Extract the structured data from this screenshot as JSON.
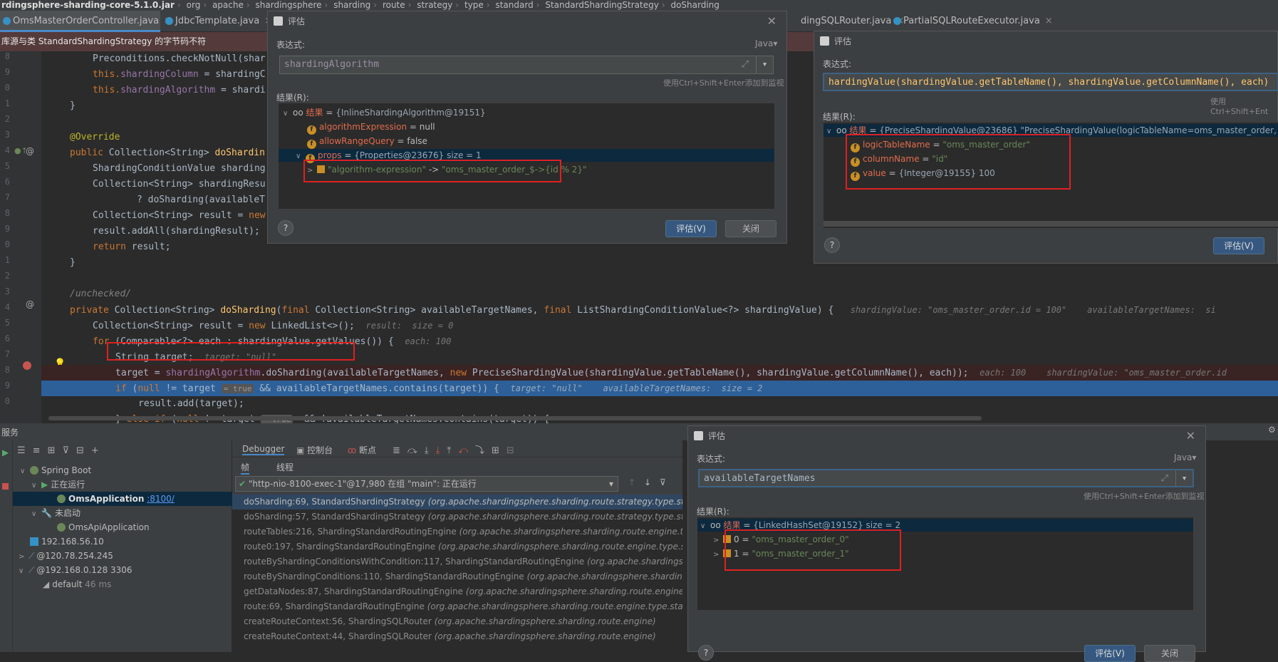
{
  "breadcrumb": [
    "rdingsphere-sharding-core-5.1.0.jar",
    "org",
    "apache",
    "shardingsphere",
    "sharding",
    "route",
    "strategy",
    "type",
    "standard",
    "StandardShardingStrategy",
    "doSharding"
  ],
  "tabs": [
    {
      "label": "OmsMasterOrderController.java",
      "active": true
    },
    {
      "label": "JdbcTemplate.java",
      "active": false
    },
    {
      "label": "dingSQLRouter.java",
      "active": false
    },
    {
      "label": "PartialSQLRouteExecutor.java",
      "active": false
    }
  ],
  "banner": "库源与类 StandardShardingStrategy 的字节码不符",
  "line_numbers": [
    "8",
    "9",
    "0",
    "1",
    "2",
    "3",
    "4",
    "5",
    "6",
    "7",
    "8",
    "9",
    "0",
    "1",
    "2",
    "3",
    "4",
    "5",
    "6",
    "7",
    "8",
    "9",
    "0"
  ],
  "code": {
    "l0": "Preconditions.checkNotNull(shar",
    "l1a": "this.",
    "l1b": "shardingColumn",
    "l1c": " = shardingC",
    "l2a": "this.",
    "l2b": "shardingAlgorithm",
    "l2c": " = shardi",
    "l3": "}",
    "l5": "@Override",
    "l6a": "public",
    "l6b": " Collection<String> ",
    "l6c": "doShardin",
    "l7": "ShardingConditionValue sharding",
    "l8": "Collection<String> shardingResu",
    "l9": "? doSharding(availableT",
    "l10a": "Collection<String> result = ",
    "l10b": "new",
    "l11": "result.addAll(shardingResult);",
    "l12a": "return",
    "l12b": " result;",
    "l13": "}",
    "l15": "/unchecked/",
    "l16a": "private",
    "l16b": " Collection<String> ",
    "l16c": "doSharding",
    "l16d": "(",
    "l16e": "final",
    "l16f": " Collection<String> availableTargetNames, ",
    "l16g": "final",
    "l16h": " ListShardingConditionValue<?> shardingValue) {",
    "l16hint": "shardingValue: \"oms_master_order.id = 100\"    availableTargetNames:  si",
    "l17a": "Collection<String> result = ",
    "l17b": "new",
    "l17c": " LinkedList<>();",
    "l17hint": "result:  size = 0",
    "l18a": "for",
    "l18b": " (Comparable<?> each : shardingValue.getValues()) {",
    "l18hint": "each: 100",
    "l19a": "String target;",
    "l19hint": "target: \"null\"",
    "l20a": "target = ",
    "l20b": "shardingAlgorithm",
    "l20c": ".doSharding(availableTargetNames, ",
    "l20d": "new",
    "l20e": " PreciseShardingValue(shardingValue.getTableName(), shardingValue.getColumnName(), each));",
    "l20hint": "each: 100    shardingValue: \"oms_master_order.id",
    "l21a": "if",
    "l21b": " (",
    "l21c": "null",
    "l21d": " != target ",
    "l21badge": "= true",
    "l21e": " && availableTargetNames.contains(target)) {",
    "l21hint": "target: \"null\"    availableTargetNames:  size = 2",
    "l22": "result.add(target);",
    "l23a": "} ",
    "l23b": "else if",
    "l23c": " (",
    "l23d": "null",
    "l23e": " != target ",
    "l23badge": "= true",
    "l23f": "  && !availableTargetNames.contains(target)) {"
  },
  "dialog1": {
    "title": "评估",
    "expr_label": "表达式:",
    "lang": "Java",
    "expression": "shardingAlgorithm",
    "hint": "使用Ctrl+Shift+Enter添加到监视",
    "result_label": "结果(R):",
    "root": {
      "key": "结果",
      "value": "{InlineShardingAlgorithm@19151}"
    },
    "rows": [
      {
        "key": "algorithmExpression",
        "value": "null"
      },
      {
        "key": "allowRangeQuery",
        "value": "false"
      },
      {
        "key": "props",
        "value": "{Properties@23676}  size = 1"
      },
      {
        "key": "\"algorithm-expression\"",
        "value": "\"oms_master_order_$->{id % 2}\""
      }
    ],
    "evaluate": "评估(V)",
    "close": "关闭"
  },
  "dialog2": {
    "title": "评估",
    "expr_label": "表达式:",
    "expression": "hardingValue(shardingValue.getTableName(), shardingValue.getColumnName(), each)",
    "hint": "使用Ctrl+Shift+Ent",
    "result_label": "结果(R):",
    "root": {
      "key": "结果",
      "value": "{PreciseShardingValue@23686} \"PreciseShardingValue(logicTableName=oms_master_order, co"
    },
    "rows": [
      {
        "key": "logicTableName",
        "value": "\"oms_master_order\""
      },
      {
        "key": "columnName",
        "value": "\"id\""
      },
      {
        "key": "value",
        "value": "{Integer@19155} 100"
      }
    ],
    "evaluate": "评估(V)"
  },
  "dialog3": {
    "title": "评估",
    "expr_label": "表达式:",
    "lang": "Java",
    "expression": "availableTargetNames",
    "hint": "使用Ctrl+Shift+Enter添加到监视",
    "result_label": "结果(R):",
    "root": {
      "key": "结果",
      "value": "{LinkedHashSet@19152}  size = 2"
    },
    "rows": [
      {
        "key": "0",
        "value": "\"oms_master_order_0\""
      },
      {
        "key": "1",
        "value": "\"oms_master_order_1\""
      }
    ],
    "evaluate": "评估(V)",
    "close": "关闭"
  },
  "services": {
    "header": "服务",
    "tree": [
      {
        "label": "Spring Boot"
      },
      {
        "label": "正在运行"
      },
      {
        "label": "OmsApplication",
        "port": ":8100/"
      },
      {
        "label": "未启动"
      },
      {
        "label": "OmsApiApplication"
      },
      {
        "label": "192.168.56.10"
      },
      {
        "label": "@120.78.254.245"
      },
      {
        "label": "@192.168.0.128 3306"
      },
      {
        "label": "default",
        "time": "46 ms"
      }
    ]
  },
  "debugger": {
    "tabs": [
      "Debugger",
      "控制台",
      "断点"
    ],
    "subtabs": [
      "帧",
      "线程"
    ],
    "thread": "\"http-nio-8100-exec-1\"@17,980 在组 \"main\": 正在运行",
    "frames": [
      {
        "method": "doSharding:69, StandardShardingStrategy",
        "pkg": "(org.apache.shardingsphere.sharding.route.strategy.type.standa"
      },
      {
        "method": "doSharding:57, StandardShardingStrategy",
        "pkg": "(org.apache.shardingsphere.sharding.route.strategy.type.standa"
      },
      {
        "method": "routeTables:216, ShardingStandardRoutingEngine",
        "pkg": "(org.apache.shardingsphere.sharding.route.engine.type"
      },
      {
        "method": "route0:197, ShardingStandardRoutingEngine",
        "pkg": "(org.apache.shardingsphere.sharding.route.engine.type.standa"
      },
      {
        "method": "routeByShardingConditionsWithCondition:117, ShardingStandardRoutingEngine",
        "pkg": "(org.apache.shardingsphere."
      },
      {
        "method": "routeByShardingConditions:110, ShardingStandardRoutingEngine",
        "pkg": "(org.apache.shardingsphere.sharding.ro"
      },
      {
        "method": "getDataNodes:87, ShardingStandardRoutingEngine",
        "pkg": "(org.apache.shardingsphere.sharding.route.engine.typ"
      },
      {
        "method": "route:69, ShardingStandardRoutingEngine",
        "pkg": "(org.apache.shardingsphere.sharding.route.engine.type.standa"
      },
      {
        "method": "createRouteContext:56, ShardingSQLRouter",
        "pkg": "(org.apache.shardingsphere.sharding.route.engine)"
      },
      {
        "method": "createRouteContext:44, ShardingSQLRouter",
        "pkg": "(org.apache.shardingsphere.sharding.route.engine)"
      }
    ]
  }
}
